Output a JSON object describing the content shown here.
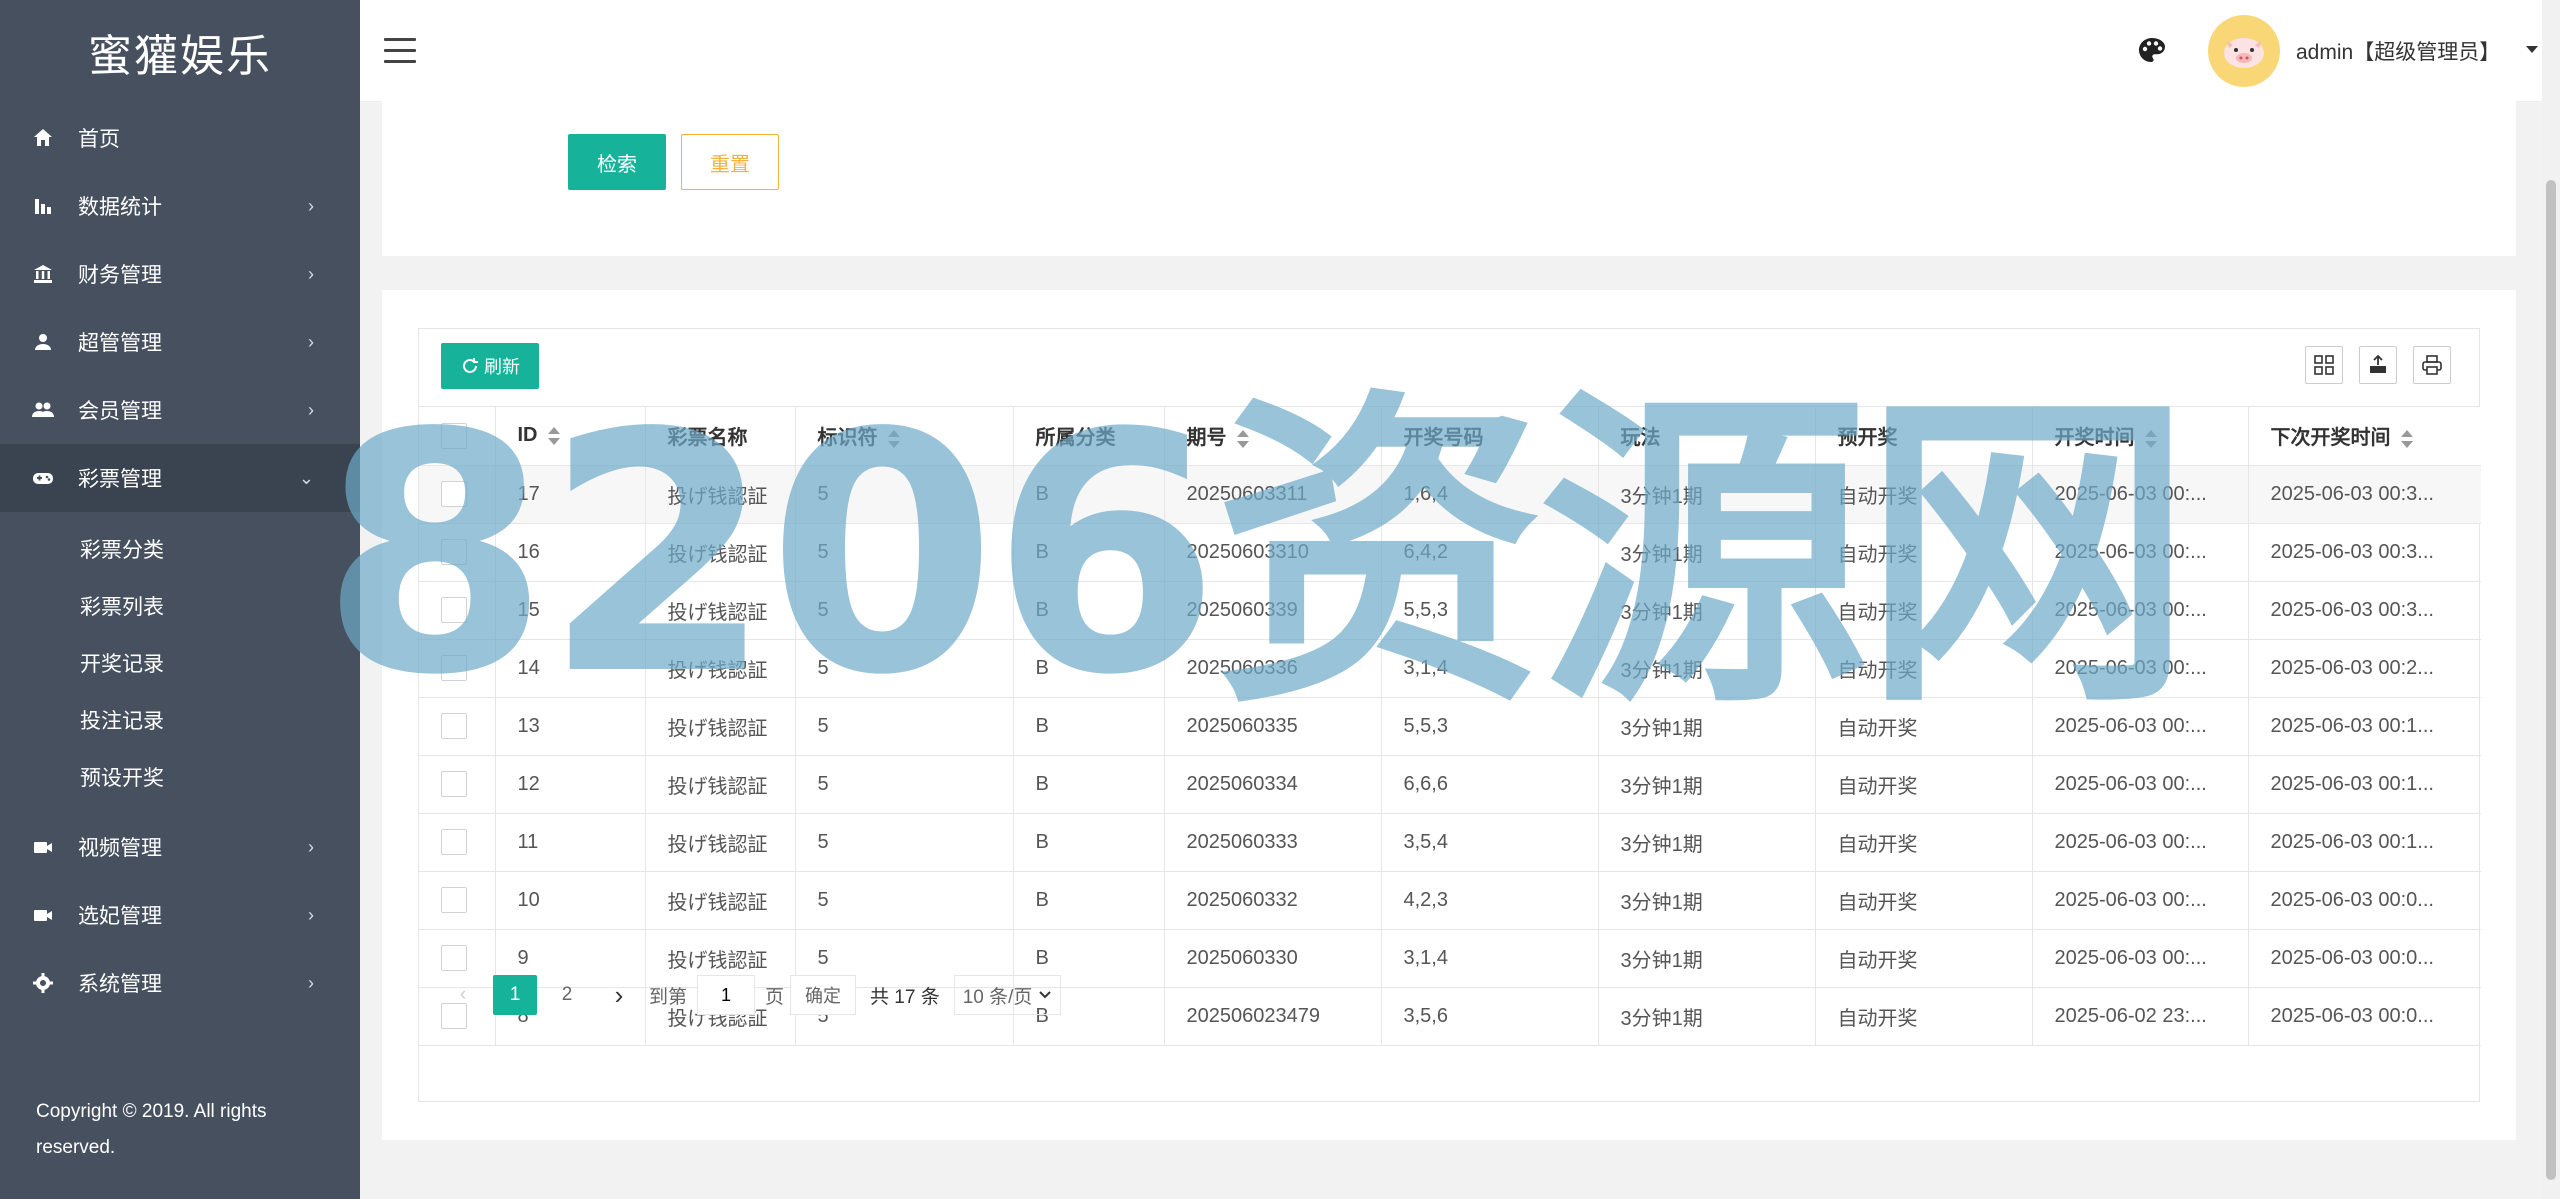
{
  "sidebar": {
    "logo": "蜜獾娱乐",
    "items": [
      {
        "label": "首页",
        "icon": "home-icon",
        "arrow": ""
      },
      {
        "label": "数据统计",
        "icon": "bar-chart-icon",
        "arrow": "›"
      },
      {
        "label": "财务管理",
        "icon": "bank-icon",
        "arrow": "›"
      },
      {
        "label": "超管管理",
        "icon": "user-icon",
        "arrow": "›"
      },
      {
        "label": "会员管理",
        "icon": "users-icon",
        "arrow": "›"
      },
      {
        "label": "彩票管理",
        "icon": "gamepad-icon",
        "arrow": "⌄"
      }
    ],
    "sub_items": [
      "彩票分类",
      "彩票列表",
      "开奖记录",
      "投注记录",
      "预设开奖"
    ],
    "items_after": [
      {
        "label": "视频管理",
        "icon": "video-icon",
        "arrow": "›"
      },
      {
        "label": "选妃管理",
        "icon": "video-icon",
        "arrow": "›"
      },
      {
        "label": "系统管理",
        "icon": "gear-icon",
        "arrow": "›"
      }
    ],
    "copyright": "Copyright © 2019. All rights reserved."
  },
  "header": {
    "user": "admin【超级管理员】"
  },
  "search": {
    "search_label": "检索",
    "reset_label": "重置"
  },
  "table": {
    "refresh_label": "刷新",
    "columns": [
      "ID",
      "彩票名称",
      "标识符",
      "所属分类",
      "期号",
      "开奖号码",
      "玩法",
      "预开奖",
      "开奖时间",
      "下次开奖时间"
    ],
    "rows": [
      [
        "17",
        "投げ钱認証",
        "5",
        "B",
        "20250603311",
        "1,6,4",
        "3分钟1期",
        "自动开奖",
        "2025-06-03 00:...",
        "2025-06-03 00:3..."
      ],
      [
        "16",
        "投げ钱認証",
        "5",
        "B",
        "20250603310",
        "6,4,2",
        "3分钟1期",
        "自动开奖",
        "2025-06-03 00:...",
        "2025-06-03 00:3..."
      ],
      [
        "15",
        "投げ钱認証",
        "5",
        "B",
        "2025060339",
        "5,5,3",
        "3分钟1期",
        "自动开奖",
        "2025-06-03 00:...",
        "2025-06-03 00:3..."
      ],
      [
        "14",
        "投げ钱認証",
        "5",
        "B",
        "2025060336",
        "3,1,4",
        "3分钟1期",
        "自动开奖",
        "2025-06-03 00:...",
        "2025-06-03 00:2..."
      ],
      [
        "13",
        "投げ钱認証",
        "5",
        "B",
        "2025060335",
        "5,5,3",
        "3分钟1期",
        "自动开奖",
        "2025-06-03 00:...",
        "2025-06-03 00:1..."
      ],
      [
        "12",
        "投げ钱認証",
        "5",
        "B",
        "2025060334",
        "6,6,6",
        "3分钟1期",
        "自动开奖",
        "2025-06-03 00:...",
        "2025-06-03 00:1..."
      ],
      [
        "11",
        "投げ钱認証",
        "5",
        "B",
        "2025060333",
        "3,5,4",
        "3分钟1期",
        "自动开奖",
        "2025-06-03 00:...",
        "2025-06-03 00:1..."
      ],
      [
        "10",
        "投げ钱認証",
        "5",
        "B",
        "2025060332",
        "4,2,3",
        "3分钟1期",
        "自动开奖",
        "2025-06-03 00:...",
        "2025-06-03 00:0..."
      ],
      [
        "9",
        "投げ钱認証",
        "5",
        "B",
        "2025060330",
        "3,1,4",
        "3分钟1期",
        "自动开奖",
        "2025-06-03 00:...",
        "2025-06-03 00:0..."
      ],
      [
        "8",
        "投げ钱認証",
        "5",
        "B",
        "202506023479",
        "3,5,6",
        "3分钟1期",
        "自动开奖",
        "2025-06-02 23:...",
        "2025-06-03 00:0..."
      ]
    ]
  },
  "pager": {
    "prev": "‹",
    "pages": [
      "1",
      "2"
    ],
    "next": "›",
    "goto_label": "到第",
    "goto_value": "1",
    "page_unit": "页",
    "confirm_label": "确定",
    "total": "共 17 条",
    "page_size": "10 条/页"
  },
  "watermark": "8206资源网",
  "colors": {
    "sidebar": "#46505f",
    "accent": "#16b39a",
    "reset": "#f3b33c"
  }
}
